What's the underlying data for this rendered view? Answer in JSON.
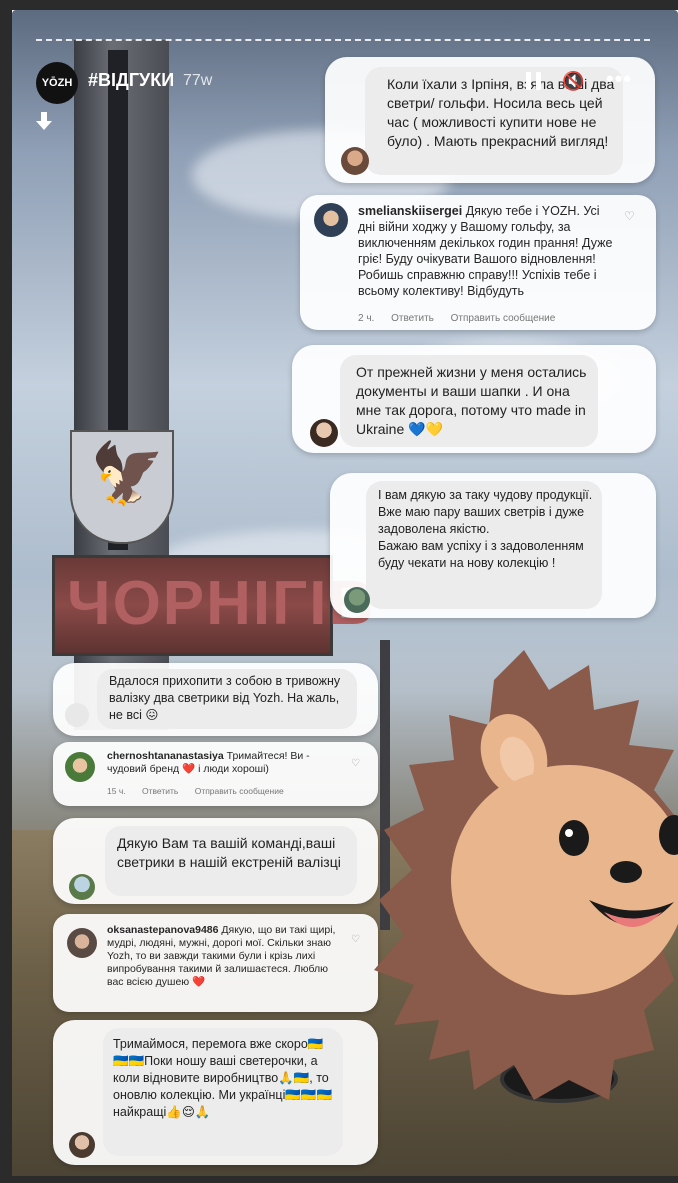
{
  "story": {
    "brand_avatar": "YŌZH",
    "title": "#ВІДГУКИ",
    "time": "77w",
    "icons": [
      "download-arrow-icon",
      "pause-icon",
      "mute-icon",
      "more-icon"
    ]
  },
  "background": {
    "sign_text": "ЧОРНІГІВ"
  },
  "comments": [
    {
      "text": "Коли їхали з Ірпіня, взяла ваші два светри/ гольфи. Носила весь цей час ( можливості купити нове не було) . Мають прекрасний вигляд!"
    },
    {
      "username": "smelianskiisergei",
      "text": " Дякую тебе і YOZH. Усі дні війни ходжу у Вашому гольфу, за виключенням декількох годин прання! Дуже гріє! Буду очікувати Вашого відновлення! Робишь справжню справу!!! Успіхів тебе і всьому колективу! Відбудуть",
      "time": "2 ч.",
      "reply": "Ответить",
      "send": "Отправить сообщение"
    },
    {
      "text": "От прежней жизни у меня остались документы и ваши шапки . И она мне так дорога, потому что made in Ukraine 💙💛"
    },
    {
      "text": "І вам дякую за таку чудову продукції. Вже маю пару ваших светрів і дуже задоволена якістю.\nБажаю вам успіху і з задоволенням буду чекати на нову колекцію !"
    },
    {
      "text": "Вдалося прихопити з собою в тривожну валізку два светрики від Yozh. На жаль, не всі 😖"
    },
    {
      "username": "chernoshtananastasiya",
      "text": " Тримайтеся! Ви - чудовий бренд ❤️ і люди хороші)",
      "time": "15 ч.",
      "reply": "Ответить",
      "send": "Отправить сообщение"
    },
    {
      "text": "Дякую Вам та вашій команді,ваші светрики в нашій екстреній валізці"
    },
    {
      "username": "oksanastepanova9486",
      "text": " Дякую, що ви такі щирі, мудрі, людяні, мужні, дорогі мої. Скільки знаю Yozh, то ви завжди такими були і крізь лихі випробування такими й залишаєтеся. Люблю вас всією душею ❤️"
    },
    {
      "text": "Тримаймося, перемога вже скоро🇺🇦🇺🇦🇺🇦Поки ношу ваші светерочки, а коли відновите виробництво🙏🇺🇦, то оновлю колекцію. Ми українці🇺🇦🇺🇦🇺🇦 найкращі👍😌🙏"
    }
  ],
  "colors": {
    "card_bg": "#ffffff",
    "bubble_bg": "#ececec",
    "heart_red": "#e0245e",
    "hedgehog_fur": "#8a5a4a",
    "hedgehog_face": "#e8b58d"
  }
}
